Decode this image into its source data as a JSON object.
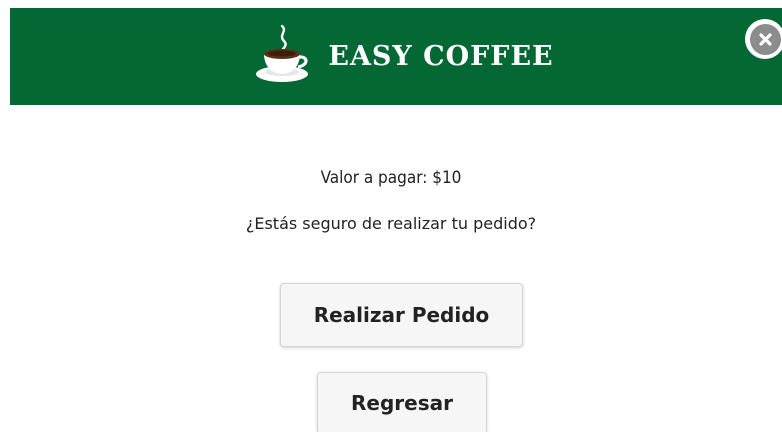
{
  "header": {
    "title": "EASY COFFEE",
    "logo_icon": "coffee-cup-icon",
    "background_color": "#036833"
  },
  "close_button": {
    "icon": "close-icon"
  },
  "body": {
    "amount_text": "Valor a pagar: $10",
    "question_text": "¿Estás seguro de realizar tu pedido?"
  },
  "buttons": {
    "confirm_label": "Realizar Pedido",
    "back_label": "Regresar"
  }
}
